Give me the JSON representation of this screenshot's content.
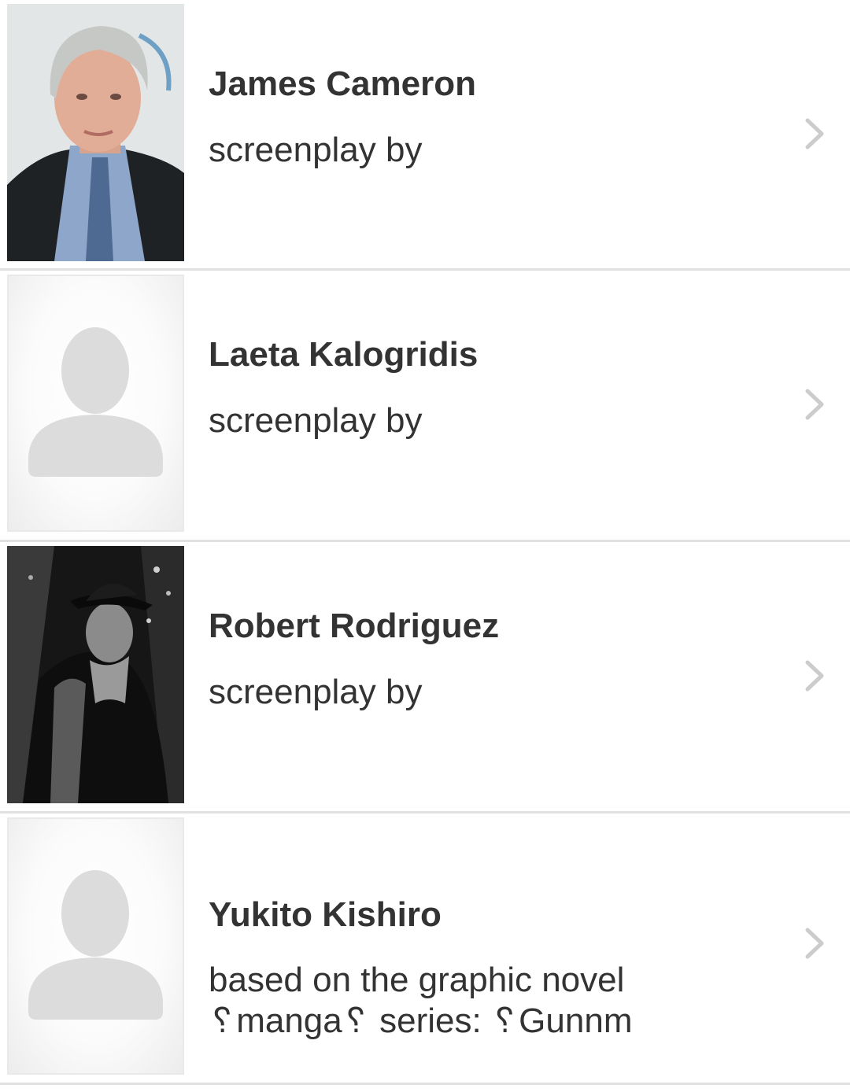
{
  "credits": [
    {
      "name": "James Cameron",
      "role": "screenplay by",
      "photo": "photo-james-cameron"
    },
    {
      "name": "Laeta Kalogridis",
      "role": "screenplay by",
      "photo": "placeholder-person-icon"
    },
    {
      "name": "Robert Rodriguez",
      "role": "screenplay by",
      "photo": "photo-robert-rodriguez"
    },
    {
      "name": "Yukito Kishiro",
      "role_line1": "based on the graphic novel",
      "role_line2": "␦manga␦ series: ␦Gunnm",
      "photo": "placeholder-person-icon"
    }
  ],
  "icons": {
    "row_action": "chevron-right-icon"
  },
  "colors": {
    "text": "#333333",
    "divider": "#e1e1e1",
    "chevron": "#cccccc",
    "placeholder_silhouette": "#dcdcdc"
  }
}
